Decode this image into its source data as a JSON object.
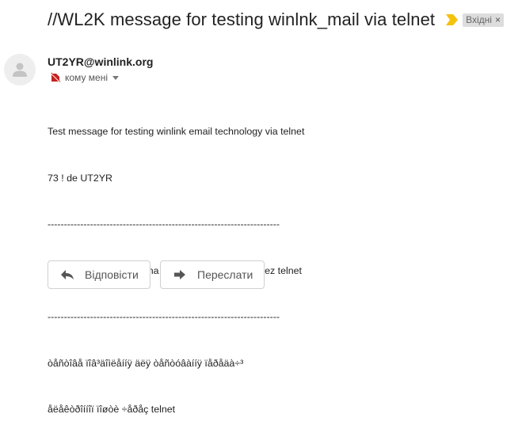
{
  "header": {
    "subject": "//WL2K message for testing winlnk_mail via telnet",
    "label": "Вхідні",
    "label_close": "×"
  },
  "message": {
    "sender": "UT2YR@winlink.org",
    "recipient": "кому мені",
    "body_lines": [
      "Test message for testing winlink email technology via telnet",
      "73 ! de UT2YR",
      "-----------------------------------------------------------------------",
      "testove povidomlennia na transliti vid UT2YR cherez telnet",
      "-----------------------------------------------------------------------",
      "òåñòîâå ïîâ³äîìëåííÿ äëÿ òåñòóâàííÿ ïåðåäà÷³",
      "åëåêòðîííîї ïîøòè ÷åðåç telnet"
    ]
  },
  "actions": {
    "reply": "Відповісти",
    "forward": "Переслати"
  },
  "colors": {
    "importance_marker": "#f4c20d",
    "label_bg": "#dddddd",
    "to_icon": "#c5221f"
  },
  "icons": {
    "importance": "importance-marker-icon",
    "avatar": "person-icon",
    "to": "restricted-recipient-icon",
    "reply": "reply-arrow-icon",
    "forward": "forward-arrow-icon"
  }
}
